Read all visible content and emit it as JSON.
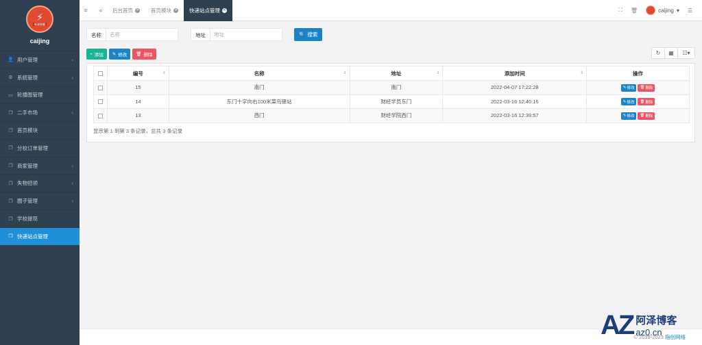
{
  "sidebar": {
    "logo_text": "新源跑腿",
    "user_name": "caijing",
    "items": [
      {
        "label": "用户管理",
        "icon": "user-icon",
        "glyph": "👤",
        "arrow": "‹",
        "active": false
      },
      {
        "label": "系统管理",
        "icon": "cogs-icon",
        "glyph": "⚙",
        "arrow": "‹",
        "active": false
      },
      {
        "label": "轮播图管理",
        "icon": "monitor-icon",
        "glyph": "▭",
        "arrow": "",
        "active": false
      },
      {
        "label": "二手市场",
        "icon": "copy-icon",
        "glyph": "❐",
        "arrow": "‹",
        "active": false
      },
      {
        "label": "首页模块",
        "icon": "copy-icon",
        "glyph": "❐",
        "arrow": "",
        "active": false
      },
      {
        "label": "分校订单管理",
        "icon": "copy-icon",
        "glyph": "❐",
        "arrow": "",
        "active": false
      },
      {
        "label": "商家管理",
        "icon": "copy-icon",
        "glyph": "❐",
        "arrow": "‹",
        "active": false
      },
      {
        "label": "失物招领",
        "icon": "copy-icon",
        "glyph": "❐",
        "arrow": "‹",
        "active": false
      },
      {
        "label": "圈子管理",
        "icon": "copy-icon",
        "glyph": "❐",
        "arrow": "‹",
        "active": false
      },
      {
        "label": "学校提现",
        "icon": "copy-icon",
        "glyph": "❐",
        "arrow": "",
        "active": false
      },
      {
        "label": "快递站点管理",
        "icon": "copy-icon",
        "glyph": "❐",
        "arrow": "",
        "active": true
      }
    ]
  },
  "topbar": {
    "tabs": [
      {
        "label": "后台首页",
        "active": false
      },
      {
        "label": "首页模块",
        "active": false
      },
      {
        "label": "快递站点管理",
        "active": true
      }
    ],
    "user_name": "caijing"
  },
  "search": {
    "name_label": "名称",
    "name_placeholder": "名称",
    "address_label": "地址",
    "address_placeholder": "地址",
    "search_button": "搜索"
  },
  "actions": {
    "add": "添加",
    "edit": "修改",
    "delete": "删除"
  },
  "table": {
    "columns": [
      "编号",
      "名称",
      "地址",
      "添加时间",
      "操作"
    ],
    "rows": [
      {
        "id": "15",
        "name": "南门",
        "address": "南门",
        "time": "2022-04-07 17:22:28"
      },
      {
        "id": "14",
        "name": "东门十字向右100米菜鸟驿站",
        "address": "财经学员东门",
        "time": "2022-03-16 12:40:16"
      },
      {
        "id": "13",
        "name": "西门",
        "address": "财经学院西门",
        "time": "2022-03-16 12:39:57"
      }
    ],
    "row_edit": "修改",
    "row_delete": "删除",
    "pagination": "显示第 1 到第 3 条记录，总共 3 条记录"
  },
  "footer": {
    "copyright": "© 2019-2023",
    "brand": "指创网络"
  },
  "watermark": {
    "mark": "AZ",
    "title": "阿泽博客",
    "subtitle": "az0.cn"
  },
  "colors": {
    "sidebar_bg": "#2f4050",
    "active_item": "#1f90d7",
    "primary": "#1c84c6",
    "success": "#1ab394",
    "danger": "#ed5565"
  }
}
